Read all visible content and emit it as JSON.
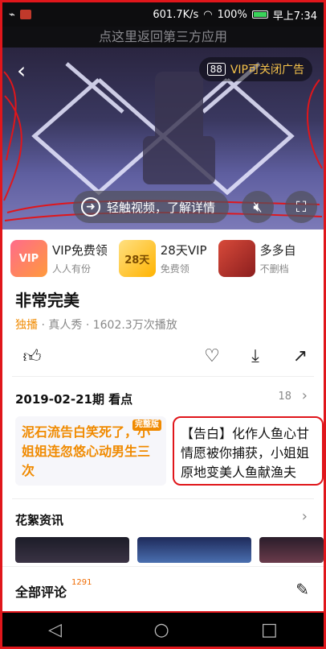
{
  "status": {
    "speed": "601.7K/s",
    "battery": "100%",
    "time": "早上7:34"
  },
  "return_bar": "点这里返回第三方应用",
  "video": {
    "vip_ad_count": "88",
    "vip_ad_label": "VIP可关闭广告",
    "learn_more": "轻触视频，了解详情"
  },
  "promos": [
    {
      "title": "VIP免费领",
      "sub": "人人有份",
      "img_text": "VIP"
    },
    {
      "title": "28天VIP",
      "sub": "免费领",
      "img_text": "28天"
    },
    {
      "title": "多多自",
      "sub": "不删档",
      "img_text": ""
    }
  ],
  "show": {
    "title": "非常完美",
    "tag": "独播",
    "category": "真人秀",
    "plays": "1602.3万次播放"
  },
  "episode": {
    "header": "2019-02-21期 看点",
    "count": "18"
  },
  "cards": [
    {
      "text": "泥石流告白笑死了，小姐姐连忽悠心动男生三次",
      "badge": "完整版"
    },
    {
      "text": "【告白】化作人鱼心甘情愿被你捕获，小姐姐原地变美人鱼献渔夫",
      "badge": ""
    }
  ],
  "news": {
    "header": "花絮资讯"
  },
  "comments": {
    "label": "全部评论",
    "count": "1291"
  },
  "colors": {
    "accent": "#f08a00",
    "highlight_border": "#e0161b"
  }
}
